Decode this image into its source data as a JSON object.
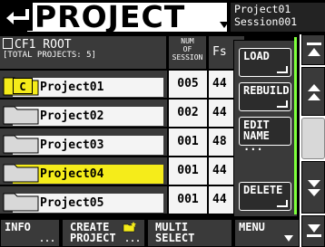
{
  "header": {
    "title": "PROJECT",
    "project_name": "Project01",
    "session_name": "Session001"
  },
  "table": {
    "hdr_name_line1": "CF1 ROOT",
    "hdr_name_line2": "[TOTAL PROJECTS: 5]",
    "hdr_num": [
      "NUM",
      "OF",
      "SESSION"
    ],
    "hdr_fs": "Fs",
    "rows": [
      {
        "name": "Project01",
        "num": "005",
        "fs": "44",
        "current_badge": "C",
        "selected": false
      },
      {
        "name": "Project02",
        "num": "002",
        "fs": "44",
        "selected": false
      },
      {
        "name": "Project03",
        "num": "001",
        "fs": "48",
        "selected": false
      },
      {
        "name": "Project04",
        "num": "001",
        "fs": "44",
        "selected": true
      },
      {
        "name": "Project05",
        "num": "001",
        "fs": "44",
        "selected": false
      }
    ]
  },
  "popup": {
    "load": "LOAD",
    "rebuild": "REBUILD",
    "edit_name_1": "EDIT",
    "edit_name_2": "NAME ...",
    "delete": "DELETE"
  },
  "footer": {
    "info": "INFO",
    "info_dots": "...",
    "create_1": "CREATE",
    "create_2": "PROJECT",
    "create_dots": "...",
    "multi_1": "MULTI",
    "multi_2": "SELECT",
    "menu": "MENU"
  },
  "colors": {
    "selected_row": "#f5ec1a",
    "panel_gray": "#3a3a3a",
    "accent_green": "#7dff3a"
  }
}
